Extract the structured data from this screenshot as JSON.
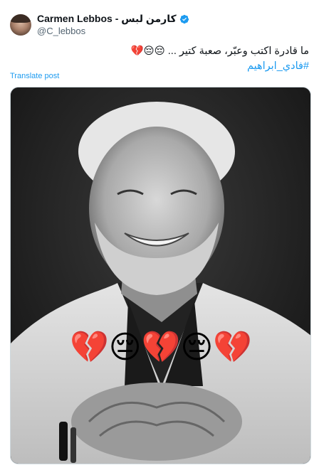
{
  "user": {
    "display_name": "Carmen Lebbos - كارمن لبس",
    "handle": "@C_lebbos",
    "verified": true,
    "avatar_icon": "profile-avatar"
  },
  "post": {
    "text": "ما قادرة اكتب وعبّر، صعبة كتير ... 😔😔💔",
    "hashtag": "#فادي_ابراهيم",
    "translate_label": "Translate post"
  },
  "media": {
    "emoji_row": "💔😔💔😔💔"
  },
  "colors": {
    "link": "#1d9bf0",
    "verified_badge": "#1d9bf0",
    "secondary_text": "#536471"
  }
}
